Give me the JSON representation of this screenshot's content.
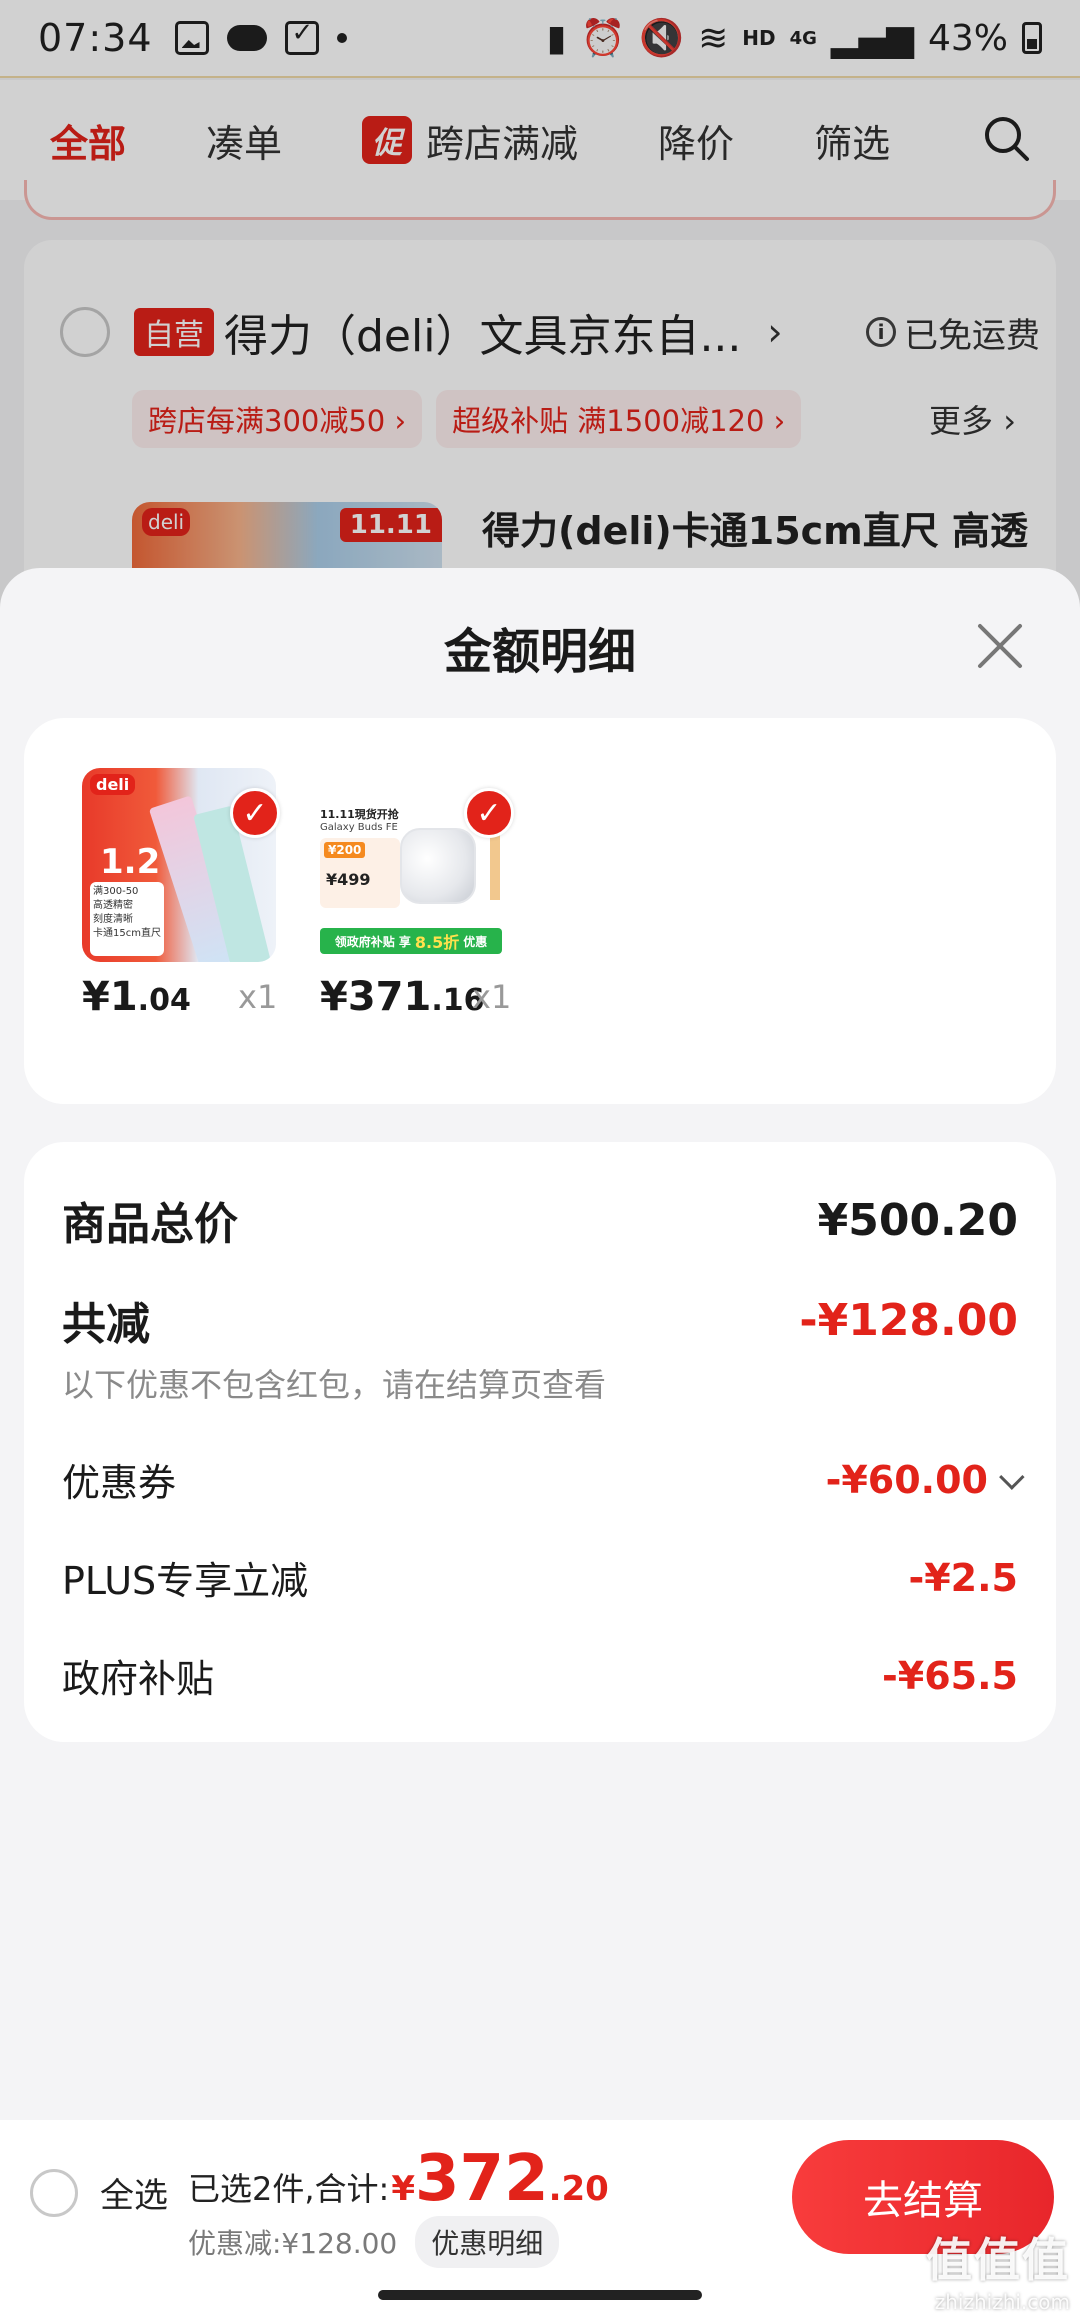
{
  "status_bar": {
    "time": "07:34",
    "network": "4G",
    "hd": "HD",
    "battery": "43%"
  },
  "filter_bar": {
    "tabs": [
      "全部",
      "凑单",
      "跨店满减",
      "降价",
      "筛选"
    ],
    "promo_tag": "促"
  },
  "store": {
    "self_badge": "自营",
    "name": "得力（deli）文具京东自...",
    "free_shipping": "已免运费",
    "chips": [
      "跨店每满300减50 ›",
      "超级补贴  满1500减120 ›"
    ],
    "more": "更多 ›",
    "product_title": "得力(deli)卡通15cm直尺 高透",
    "thumb_brand": "deli",
    "thumb_tag": "11.11"
  },
  "sheet": {
    "title": "金额明细",
    "items": [
      {
        "price_int": "¥1",
        "price_dec": ".04",
        "qty": "x1",
        "art": {
          "brand": "deli",
          "big": "1.2",
          "box_lines": [
            "满300-50",
            "高透精密",
            "刻度清晰",
            "卡通15cm直尺"
          ]
        }
      },
      {
        "price_int": "¥371",
        "price_dec": ".16",
        "qty": "x1",
        "art": {
          "headline": "11.11現货开抢",
          "sub": "Galaxy Buds FE",
          "coupon": "¥200",
          "price": "¥499",
          "green_text": "领政府补贴 享",
          "green_big": "8.5折",
          "green_tail": "优惠"
        }
      }
    ],
    "summary": {
      "total_label": "商品总价",
      "total_value": "¥500.20",
      "discount_label": "共减",
      "discount_value": "-¥128.00",
      "note": "以下优惠不包含红包，请在结算页查看",
      "rows": [
        {
          "label": "优惠券",
          "value": "-¥60.00"
        },
        {
          "label": "PLUS专享立减",
          "value": "-¥2.5"
        },
        {
          "label": "政府补贴",
          "value": "-¥65.5"
        }
      ]
    }
  },
  "bottom_bar": {
    "select_all": "全选",
    "selected_text": "已选2件,合计:",
    "total_yen": "¥",
    "total_int": "372",
    "total_dec": ".20",
    "discount_text": "优惠减:¥128.00",
    "detail_chip": "优惠明细",
    "checkout": "去结算"
  },
  "watermark": {
    "logo": "值值值",
    "url": "zhizhizhi.com"
  },
  "colors": {
    "accent": "#e2231a",
    "sheet_bg": "#f4f4f6",
    "card_bg": "#ffffff"
  }
}
